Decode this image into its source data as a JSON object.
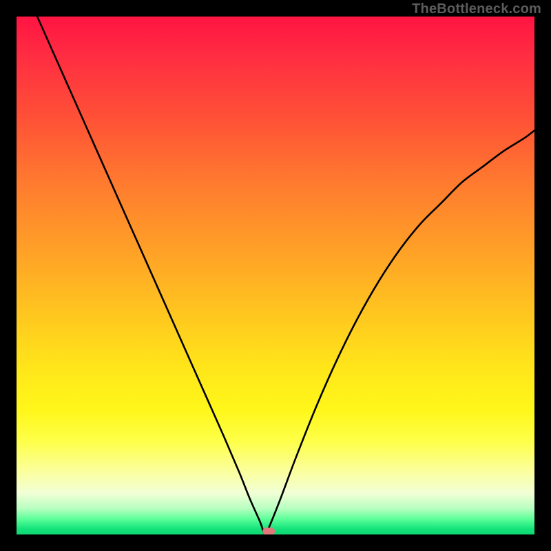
{
  "watermark": "TheBottleneck.com",
  "colors": {
    "frame_border": "#000000",
    "curve_stroke": "#000000",
    "marker_fill": "#e07a7a",
    "gradient_top": "#ff1442",
    "gradient_bottom": "#0fd873"
  },
  "chart_data": {
    "type": "line",
    "title": "",
    "xlabel": "",
    "ylabel": "",
    "xlim": [
      0,
      100
    ],
    "ylim": [
      0,
      100
    ],
    "axes_visible": false,
    "legend": false,
    "description": "Absolute-deviation style bottleneck curve with a single minimum near x≈48; background encodes value via vertical red→green gradient.",
    "minimum": {
      "x": 48,
      "y": 0
    },
    "marker": {
      "x": 48.7,
      "y": 0.6,
      "shape": "capsule"
    },
    "series": [
      {
        "name": "bottleneck-curve",
        "x": [
          4,
          8,
          12,
          16,
          20,
          24,
          28,
          32,
          36,
          40,
          43,
          45,
          47,
          48,
          49,
          51,
          54,
          58,
          62,
          66,
          70,
          74,
          78,
          82,
          86,
          90,
          94,
          98,
          100
        ],
        "y": [
          100,
          91,
          82,
          73,
          64,
          55,
          46,
          37,
          28,
          19,
          12,
          7,
          2.5,
          0,
          2,
          7,
          15,
          25,
          34,
          42,
          49,
          55,
          60,
          64,
          68,
          71,
          74,
          76.5,
          78
        ]
      }
    ]
  }
}
